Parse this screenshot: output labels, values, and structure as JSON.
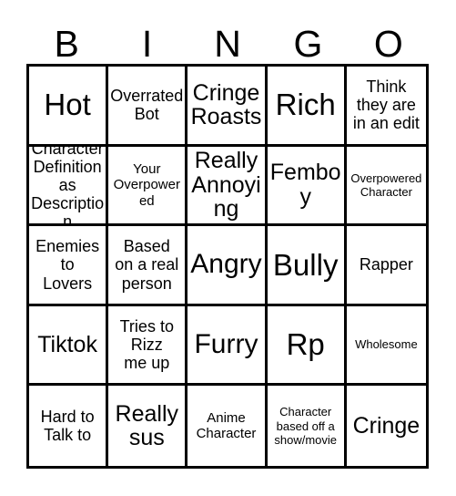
{
  "card": {
    "title": "BINGO",
    "headers": [
      "B",
      "I",
      "N",
      "G",
      "O"
    ],
    "grid_size": "5x5",
    "border_color": "#000000",
    "background_color": "#ffffff",
    "text_color": "#000000"
  },
  "cells": [
    {
      "id": "b1",
      "column": "B",
      "row": 1,
      "text": "Hot",
      "size": "sz-xl"
    },
    {
      "id": "i1",
      "column": "I",
      "row": 1,
      "text": "Overrated\nBot",
      "size": "sz-sm"
    },
    {
      "id": "n1",
      "column": "N",
      "row": 1,
      "text": "Cringe\nRoasts",
      "size": "sz-md"
    },
    {
      "id": "g1",
      "column": "G",
      "row": 1,
      "text": "Rich",
      "size": "sz-xl"
    },
    {
      "id": "o1",
      "column": "O",
      "row": 1,
      "text": "Think\nthey are\nin an edit",
      "size": "sz-sm"
    },
    {
      "id": "b2",
      "column": "B",
      "row": 2,
      "text": "Character\nDefinition\nas\nDescription",
      "size": "sz-sm"
    },
    {
      "id": "i2",
      "column": "I",
      "row": 2,
      "text": "Your\nOverpowered",
      "size": "sz-xs"
    },
    {
      "id": "n2",
      "column": "N",
      "row": 2,
      "text": "Really\nAnnoying",
      "size": "sz-md"
    },
    {
      "id": "g2",
      "column": "G",
      "row": 2,
      "text": "Femboy",
      "size": "sz-md"
    },
    {
      "id": "o2",
      "column": "O",
      "row": 2,
      "text": "Overpowered\nCharacter",
      "size": "sz-xxs"
    },
    {
      "id": "b3",
      "column": "B",
      "row": 3,
      "text": "Enemies\nto\nLovers",
      "size": "sz-sm"
    },
    {
      "id": "i3",
      "column": "I",
      "row": 3,
      "text": "Based\non a real\nperson",
      "size": "sz-sm"
    },
    {
      "id": "n3",
      "column": "N",
      "row": 3,
      "text": "Angry",
      "size": "sz-lg"
    },
    {
      "id": "g3",
      "column": "G",
      "row": 3,
      "text": "Bully",
      "size": "sz-xl"
    },
    {
      "id": "o3",
      "column": "O",
      "row": 3,
      "text": "Rapper",
      "size": "sz-sm"
    },
    {
      "id": "b4",
      "column": "B",
      "row": 4,
      "text": "Tiktok",
      "size": "sz-md"
    },
    {
      "id": "i4",
      "column": "I",
      "row": 4,
      "text": "Tries to\nRizz\nme up",
      "size": "sz-sm"
    },
    {
      "id": "n4",
      "column": "N",
      "row": 4,
      "text": "Furry",
      "size": "sz-lg"
    },
    {
      "id": "g4",
      "column": "G",
      "row": 4,
      "text": "Rp",
      "size": "sz-xl"
    },
    {
      "id": "o4",
      "column": "O",
      "row": 4,
      "text": "Wholesome",
      "size": "sz-xxs"
    },
    {
      "id": "b5",
      "column": "B",
      "row": 5,
      "text": "Hard to\nTalk to",
      "size": "sz-sm"
    },
    {
      "id": "i5",
      "column": "I",
      "row": 5,
      "text": "Really\nsus",
      "size": "sz-md"
    },
    {
      "id": "n5",
      "column": "N",
      "row": 5,
      "text": "Anime\nCharacter",
      "size": "sz-xs"
    },
    {
      "id": "g5",
      "column": "G",
      "row": 5,
      "text": "Character\nbased off a\nshow/movie",
      "size": "sz-xxs"
    },
    {
      "id": "o5",
      "column": "O",
      "row": 5,
      "text": "Cringe",
      "size": "sz-md"
    }
  ]
}
